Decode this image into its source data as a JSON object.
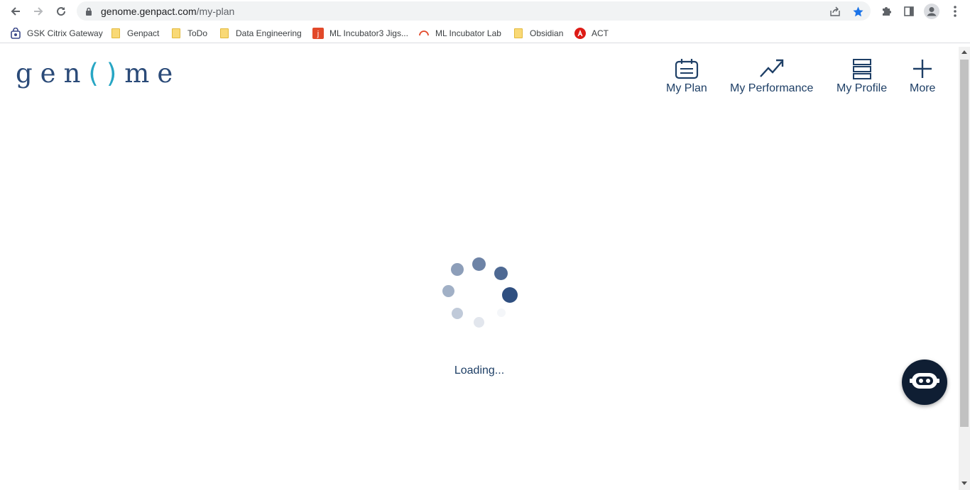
{
  "browser": {
    "url_host": "genome.genpact.com",
    "url_path": "/my-plan",
    "nav_icons": [
      "back-icon",
      "forward-icon",
      "reload-icon"
    ],
    "toolbar_icons": [
      "share-icon",
      "bookmark-star-icon",
      "extensions-icon",
      "side-panel-icon",
      "profile-icon",
      "menu-icon"
    ],
    "accent_color": "#1a73e8"
  },
  "bookmarks": [
    {
      "label": "GSK Citrix Gateway",
      "icon": "citrix-icon"
    },
    {
      "label": "Genpact",
      "icon": "folder-icon"
    },
    {
      "label": "ToDo",
      "icon": "folder-icon"
    },
    {
      "label": "Data Engineering",
      "icon": "folder-icon"
    },
    {
      "label": "ML Incubator3 Jigs...",
      "icon": "jira-icon"
    },
    {
      "label": "ML Incubator Lab",
      "icon": "lab-icon"
    },
    {
      "label": "Obsidian",
      "icon": "folder-icon"
    },
    {
      "label": "ACT",
      "icon": "angular-icon"
    }
  ],
  "page": {
    "logo": {
      "prefix": "gen",
      "o": "()",
      "suffix": "me"
    },
    "brand_color": "#1e3f66",
    "logo_accent_color": "#27a6c4",
    "nav": [
      {
        "label": "My Plan",
        "icon": "calendar-icon"
      },
      {
        "label": "My Performance",
        "icon": "trend-up-icon"
      },
      {
        "label": "My Profile",
        "icon": "profile-stack-icon"
      },
      {
        "label": "More",
        "icon": "plus-icon"
      }
    ],
    "loading_text": "Loading...",
    "chatbot_icon": "chatbot-icon"
  }
}
